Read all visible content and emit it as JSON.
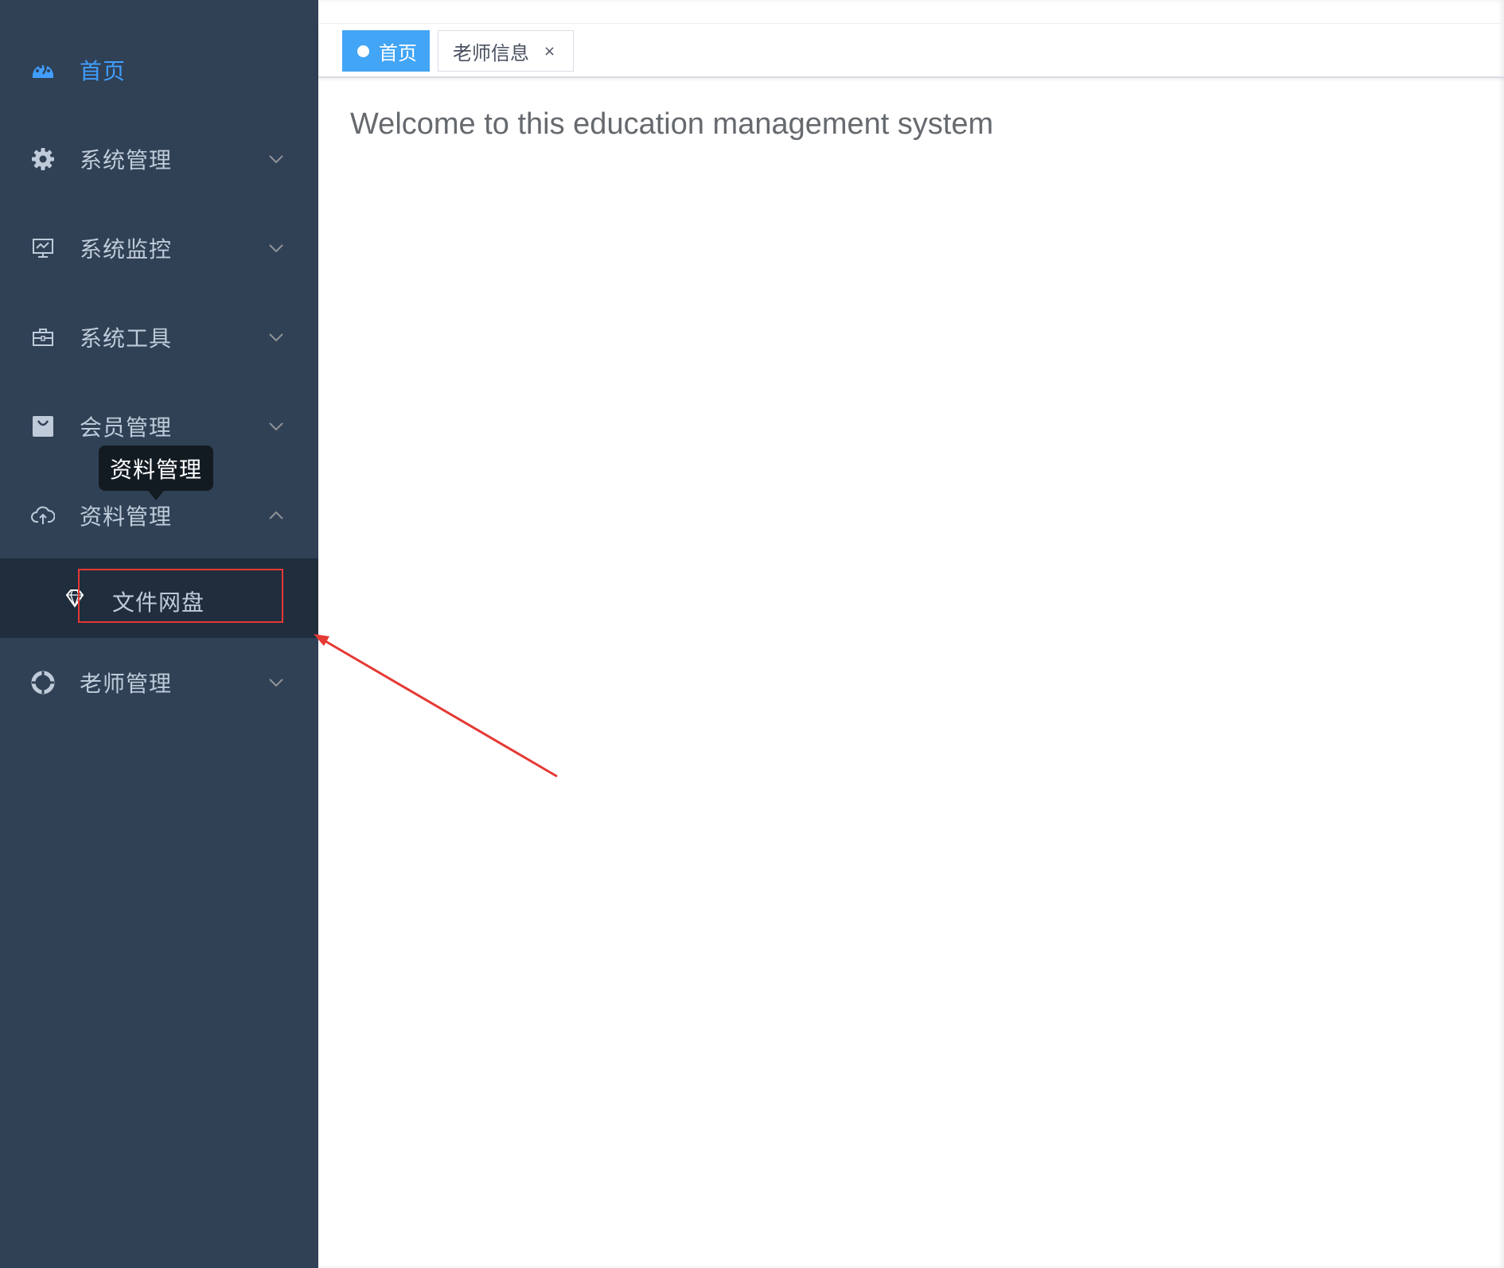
{
  "colors": {
    "sidebar_bg": "#304156",
    "submenu_bg": "#1f2d3d",
    "active": "#409eff",
    "menu_text": "#bfcbd9",
    "annotation_red": "#e53935",
    "home_tag_bg": "#42a5f5"
  },
  "sidebar": {
    "items": [
      {
        "label": "首页",
        "icon": "dashboard-icon",
        "active": true
      },
      {
        "label": "系统管理",
        "icon": "gear-icon",
        "chevron": "chevron-down-icon"
      },
      {
        "label": "系统监控",
        "icon": "monitor-icon",
        "chevron": "chevron-down-icon"
      },
      {
        "label": "系统工具",
        "icon": "toolbox-icon",
        "chevron": "chevron-down-icon"
      },
      {
        "label": "会员管理",
        "icon": "shopping-bag-icon",
        "chevron": "chevron-down-icon"
      },
      {
        "label": "资料管理",
        "icon": "cloud-upload-icon",
        "chevron": "chevron-up-icon",
        "expanded": true
      },
      {
        "label": "老师管理",
        "icon": "lifebuoy-icon",
        "chevron": "chevron-down-icon"
      }
    ],
    "submenu": [
      {
        "label": "文件网盘",
        "icon": "diamond-icon"
      }
    ],
    "tooltip": "资料管理"
  },
  "tags": [
    {
      "label": "首页",
      "active": true
    },
    {
      "label": "老师信息",
      "close": "×"
    }
  ],
  "main": {
    "welcome": "Welcome to this education management system"
  }
}
